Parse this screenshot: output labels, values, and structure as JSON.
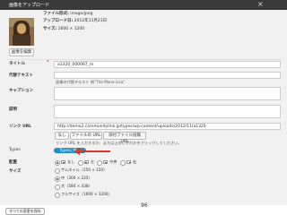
{
  "titlebar": {
    "title": "画像をアップロード",
    "close": "×"
  },
  "file": {
    "type_label": "ファイル形式:",
    "type_value": "image/jpeg",
    "uploaded_label": "アップロード日:",
    "uploaded_value": "2012年11月23日",
    "size_label": "サイズ:",
    "size_value": "1600 × 1200"
  },
  "edit_image_button": "画像を編集",
  "form": {
    "title_label": "タイトル",
    "title_required": "*",
    "title_value": "a1320_000067_m",
    "alt_label": "代替テキスト",
    "alt_value": "",
    "alt_help": "画像の代替テキスト 例\"The Mona Lisa\"",
    "caption_label": "キャプション",
    "caption_value": "",
    "description_label": "説明",
    "description_value": "",
    "link_label": "リンク URL",
    "link_value": "http://demo2.communitylink.jp/types/wp-content/uploads/2012/11/a1320",
    "link_buttons": [
      "なし",
      "ファイルの URL",
      "添付ファイル投稿 URL"
    ],
    "link_help": "リンク URL を入力するか、または上のいずれかをクリックしてください。",
    "types_label": "Types",
    "types_button": "Typesに挿入",
    "align_label": "配置",
    "align_options": [
      "なし",
      "左",
      "中央",
      "右"
    ],
    "align_selected": 0,
    "size_label": "サイズ",
    "size_options": [
      "サムネイル（150 × 150）",
      "中（300 × 225）",
      "大（584 × 438）",
      "フルサイズ（1600 × 1200）"
    ],
    "size_selected": 1
  },
  "save_all_button": "すべての変更を保存",
  "page_number": "96",
  "colors": {
    "accent": "#1c8ec9",
    "arrow": "#d43a2a",
    "titlebar": "#3a3a3a"
  }
}
